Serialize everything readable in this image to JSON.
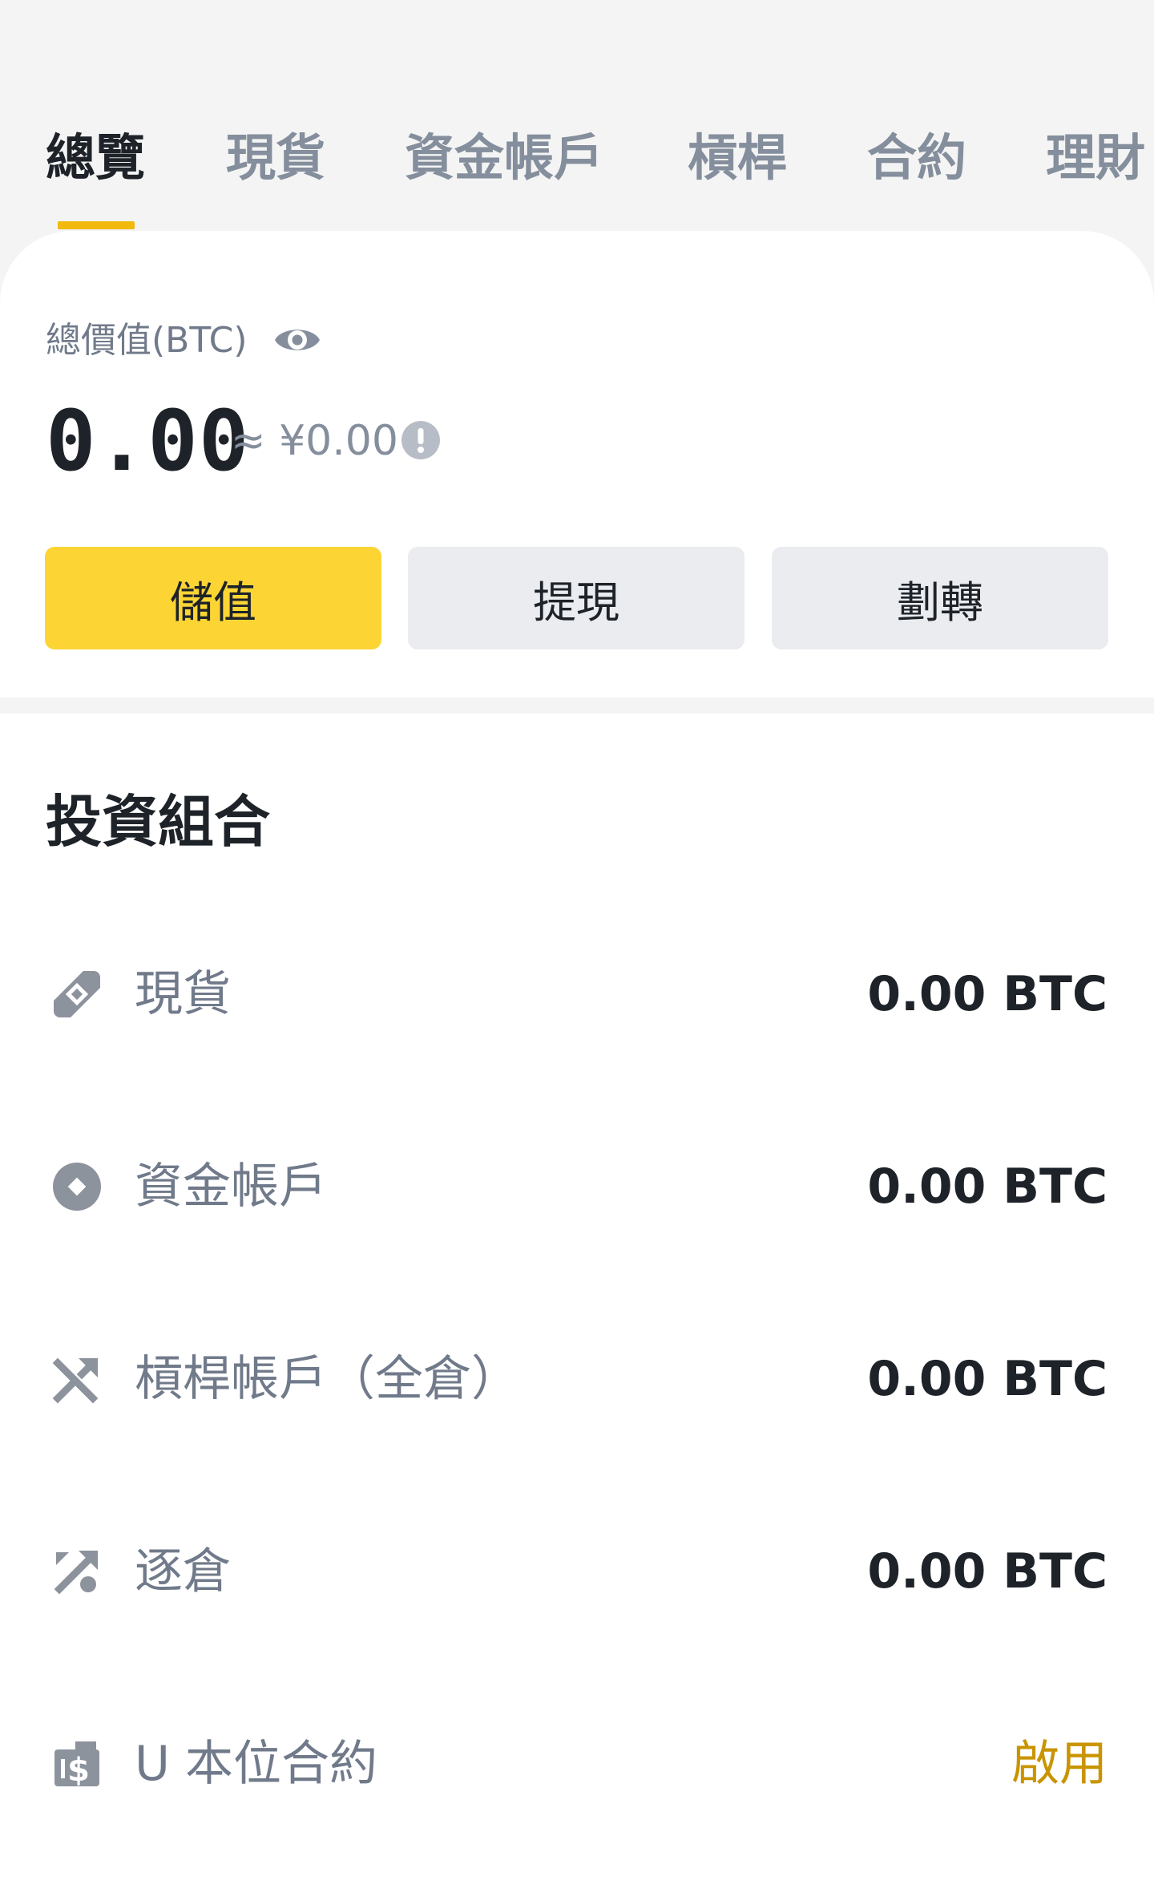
{
  "tabs": [
    {
      "label": "總覽",
      "active": true
    },
    {
      "label": "現貨",
      "active": false
    },
    {
      "label": "資金帳戶",
      "active": false
    },
    {
      "label": "槓桿",
      "active": false
    },
    {
      "label": "合約",
      "active": false
    },
    {
      "label": "理財",
      "active": false
    }
  ],
  "overview": {
    "total_label": "總價值(BTC)",
    "balance": "0.00",
    "fiat_equivalent": "≈ ¥0.00"
  },
  "actions": {
    "deposit": "儲值",
    "withdraw": "提現",
    "transfer": "劃轉"
  },
  "portfolio": {
    "title": "投資組合",
    "rows": [
      {
        "label": "現貨",
        "value": "0.00 BTC",
        "icon": "spot-icon"
      },
      {
        "label": "資金帳戶",
        "value": "0.00 BTC",
        "icon": "funding-icon"
      },
      {
        "label": "槓桿帳戶（全倉）",
        "value": "0.00 BTC",
        "icon": "cross-margin-icon"
      },
      {
        "label": "逐倉",
        "value": "0.00 BTC",
        "icon": "isolated-margin-icon"
      },
      {
        "label": "U 本位合約",
        "value": "啟用",
        "icon": "usd-futures-icon"
      }
    ]
  },
  "colors": {
    "accent": "#f0b90b",
    "primary_button": "#fcd535",
    "secondary_button": "#eaecef",
    "enable_link": "#c99400",
    "text_primary": "#1e2329",
    "text_secondary": "#707a8a",
    "icon_gray": "#8d939c"
  }
}
